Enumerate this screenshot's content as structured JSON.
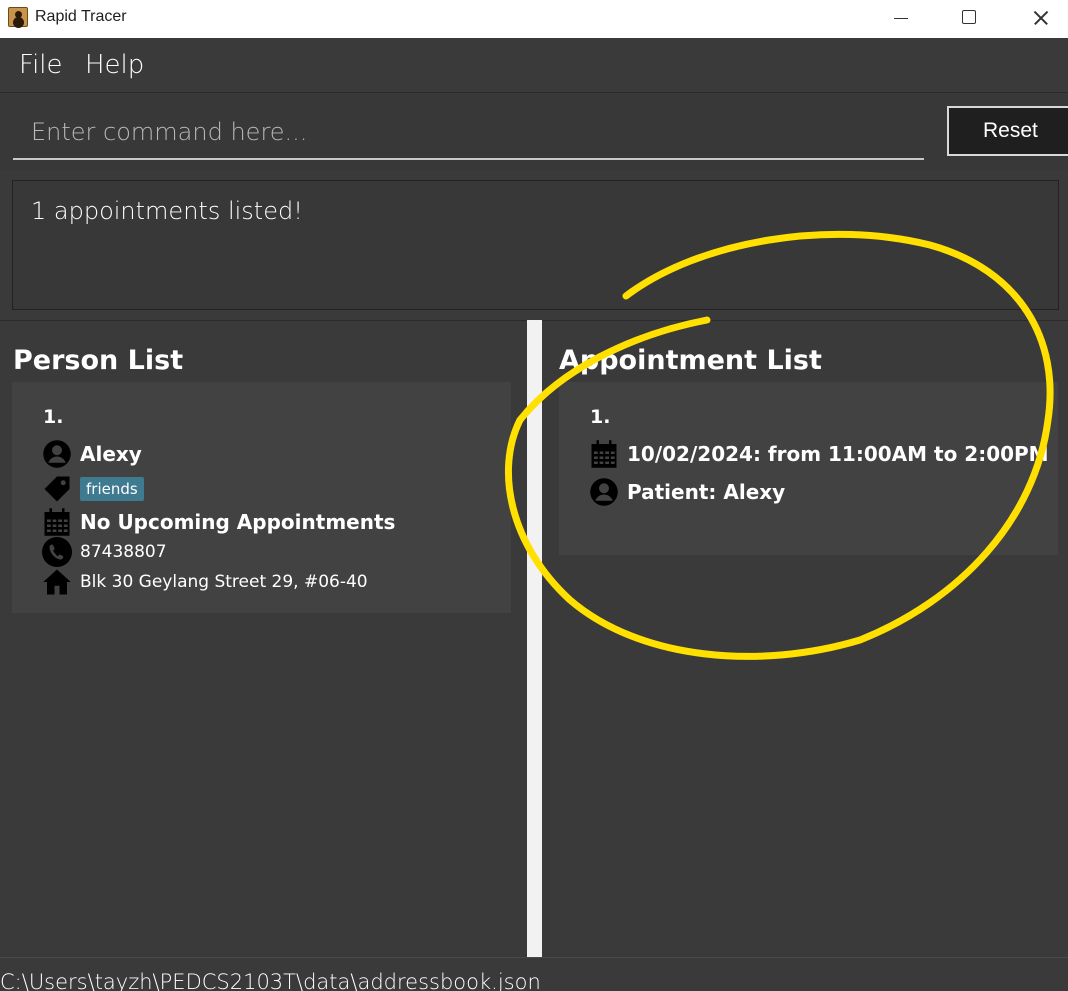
{
  "window": {
    "title": "Rapid Tracer"
  },
  "menu": {
    "items": [
      "File",
      "Help"
    ]
  },
  "command": {
    "placeholder": "Enter command here...",
    "value": "",
    "reset_label": "Reset"
  },
  "result": {
    "message": "1 appointments listed!"
  },
  "person_list": {
    "title": "Person List",
    "items": [
      {
        "index": "1.",
        "name": "Alexy",
        "tag": "friends",
        "appointments": "No Upcoming Appointments",
        "phone": "87438807",
        "address": "Blk 30 Geylang Street 29, #06-40"
      }
    ]
  },
  "appointment_list": {
    "title": "Appointment List",
    "items": [
      {
        "index": "1.",
        "datetime": "10/02/2024: from 11:00AM to 2:00PM",
        "patient": "Patient: Alexy"
      }
    ]
  },
  "status_bar": {
    "path": "C:\\Users\\tayzh\\PEDCS2103T\\data\\addressbook.json"
  },
  "colors": {
    "background": "#3a3a3a",
    "card": "#424242",
    "tag": "#3e7b91",
    "annotation": "#ffe000"
  },
  "icons": [
    "person-icon",
    "tag-icon",
    "calendar-icon",
    "phone-icon",
    "home-icon"
  ]
}
